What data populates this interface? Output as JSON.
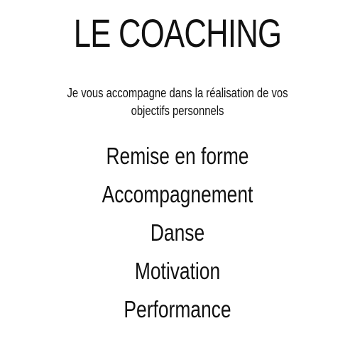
{
  "title": "LE COACHING",
  "subtitle": "Je vous accompagne dans la réalisation de vos objectifs personnels",
  "services": [
    "Remise en forme",
    "Accompagnement",
    "Danse",
    "Motivation",
    "Performance"
  ],
  "colors": {
    "background": "#ffffff",
    "text": "#111111"
  }
}
